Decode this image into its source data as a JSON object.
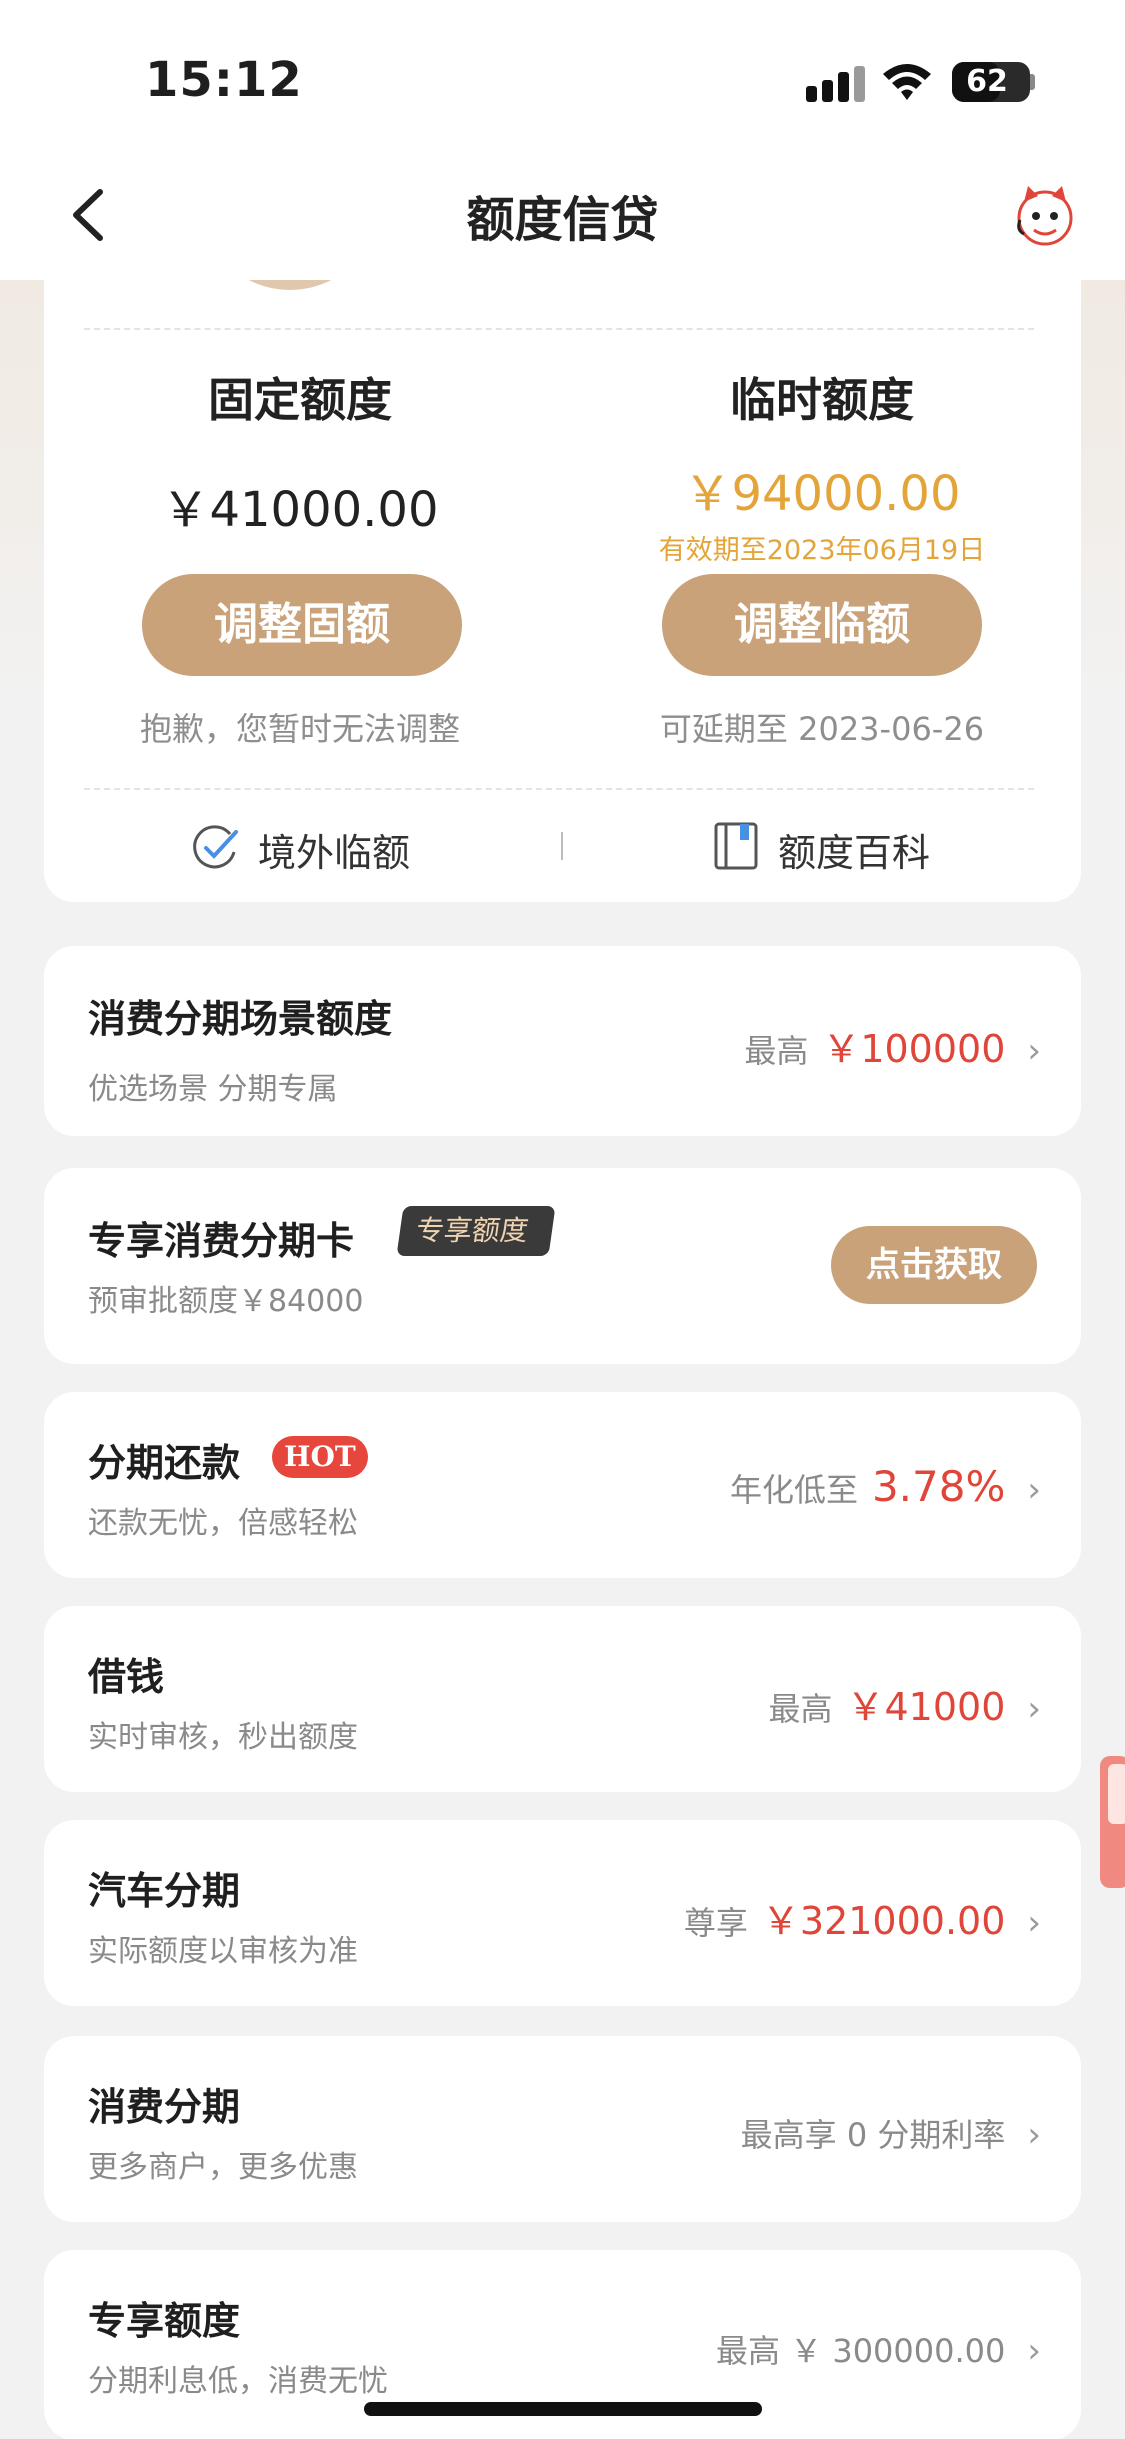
{
  "status_bar": {
    "time": "15:12",
    "battery": "62",
    "battery_level": 0.62
  },
  "nav": {
    "title": "额度信贷"
  },
  "quota": {
    "fixed": {
      "title": "固定额度",
      "amount": "￥41000.00",
      "button": "调整固额",
      "hint": "抱歉，您暂时无法调整"
    },
    "temp": {
      "title": "临时额度",
      "amount": "￥94000.00",
      "expire": "有效期至2023年06月19日",
      "button": "调整临额",
      "hint": "可延期至 2023-06-26"
    },
    "links": {
      "overseas": "境外临额",
      "wiki": "额度百科"
    }
  },
  "cards": {
    "scene": {
      "title": "消费分期场景额度",
      "sub": "优选场景 分期专属",
      "prefix": "最高",
      "value": "￥100000"
    },
    "exclusive_card": {
      "title": "专享消费分期卡",
      "tag": "专享额度",
      "sub": "预审批额度￥84000",
      "button": "点击获取"
    },
    "installment_repay": {
      "title": "分期还款",
      "tag": "HOT",
      "sub": "还款无忧，倍感轻松",
      "prefix": "年化低至",
      "value": "3.78%"
    },
    "borrow": {
      "title": "借钱",
      "sub": "实时审核，秒出额度",
      "prefix": "最高",
      "value": "￥41000"
    },
    "car": {
      "title": "汽车分期",
      "sub": "实际额度以审核为准",
      "prefix": "尊享",
      "value": "￥321000.00"
    },
    "consume": {
      "title": "消费分期",
      "sub": "更多商户，更多优惠",
      "text": "最高享 0 分期利率"
    },
    "exclusive_quota": {
      "title": "专享额度",
      "sub": "分期利息低，消费无忧",
      "text": "最高 ￥ 300000.00"
    }
  },
  "colors": {
    "accent_gold": "#c9a27a",
    "orange": "#e3a53a",
    "red": "#e0453a"
  },
  "icons": [
    "back-chevron-icon",
    "mascot-icon",
    "overseas-plane-icon",
    "book-icon",
    "chevron-right-icon"
  ]
}
